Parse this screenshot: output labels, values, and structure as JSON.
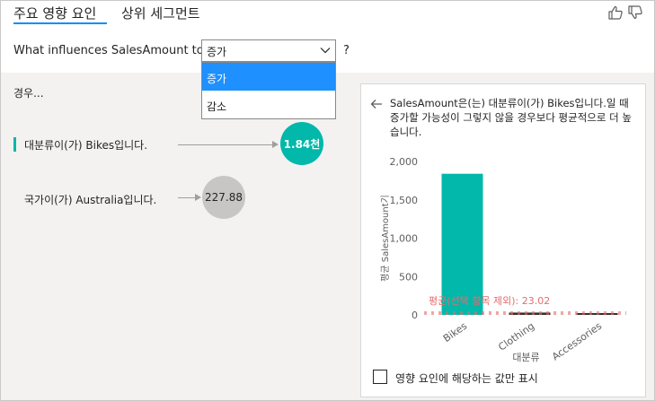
{
  "tabs": [
    {
      "label": "주요 영향 요인",
      "active": true
    },
    {
      "label": "상위 세그먼트",
      "active": false
    }
  ],
  "icons": {
    "like": "thumbs-up-icon",
    "dislike": "thumbs-down-icon",
    "back": "arrow-left-icon",
    "dropdown": "chevron-down-icon"
  },
  "question": {
    "prefix": "What influences SalesAmount to",
    "selected": "증가",
    "options": [
      "증가",
      "감소"
    ],
    "help": "?"
  },
  "left_panel": {
    "when_label": "경우...",
    "influencers": [
      {
        "label": "대분류이(가) Bikes입니다.",
        "value": "1.84천",
        "highlighted": true
      },
      {
        "label": "국가이(가) Australia입니다.",
        "value": "227.88",
        "highlighted": false
      }
    ]
  },
  "detail": {
    "text": "SalesAmount은(는) 대분류이(가) Bikes입니다.일 때 증가할 가능성이 그렇지 않을 경우보다 평균적으로 더 높습니다.",
    "checkbox_label": "영향 요인에 해당하는 값만 표시"
  },
  "chart_data": {
    "type": "bar",
    "categories": [
      "Bikes",
      "Clothing",
      "Accessories"
    ],
    "values": [
      1840,
      30,
      12
    ],
    "xlabel": "대분류",
    "ylabel": "평균 SalesAmount기",
    "ylim": [
      0,
      2000
    ],
    "yticks": [
      0,
      500,
      1000,
      1500,
      2000
    ],
    "ytick_labels": [
      "0",
      "500",
      "1,000",
      "1,500",
      "2,000"
    ],
    "grid": false,
    "reference_line": {
      "label": "평균(선택 항목 제외): 23.02",
      "value": 23.02
    },
    "colors": {
      "highlight": "#01b8aa",
      "other": "#323130",
      "reference": "#e66c6c"
    }
  }
}
